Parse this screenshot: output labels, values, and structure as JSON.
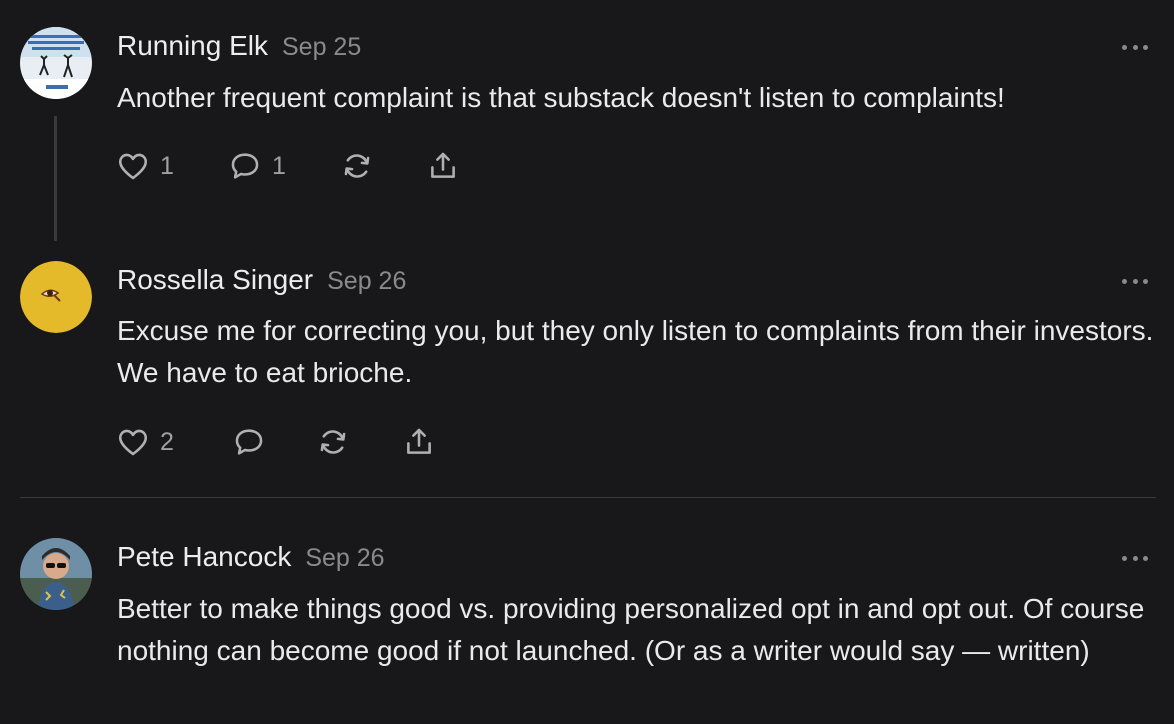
{
  "comments": [
    {
      "author": "Running Elk",
      "date": "Sep 25",
      "text": "Another frequent complaint is that substack doesn't listen to complaints!",
      "likes": "1",
      "replies": "1"
    },
    {
      "author": "Rossella Singer",
      "date": "Sep 26",
      "text": "Excuse me for correcting you, but they only listen to complaints from their investors. We have to eat brioche.",
      "likes": "2",
      "replies": ""
    },
    {
      "author": "Pete Hancock",
      "date": "Sep 26",
      "text": "Better to make things good vs. providing personalized opt in and opt out. Of course nothing can become good if not launched. (Or as a writer would say — written)"
    }
  ],
  "icons": {
    "like": "heart-icon",
    "reply": "comment-bubble-icon",
    "restack": "restack-icon",
    "share": "share-icon",
    "more": "more-options-icon"
  }
}
